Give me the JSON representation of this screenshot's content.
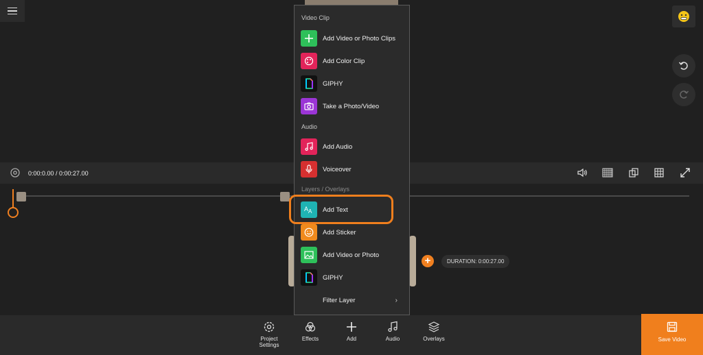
{
  "timeline": {
    "time": "0:00:0.00 / 0:00:27.00",
    "duration": "DURATION: 0:00:27.00"
  },
  "menu": {
    "sections": {
      "video_clip": "Video Clip",
      "audio": "Audio",
      "layers": "Layers / Overlays"
    },
    "items": [
      {
        "label": "Add Video or Photo Clips",
        "icon": "plus-icon",
        "color": "#2ec05a"
      },
      {
        "label": "Add Color Clip",
        "icon": "palette-icon",
        "color": "#e2245a"
      },
      {
        "label": "GIPHY",
        "icon": "giphy-icon",
        "color": "#111111"
      },
      {
        "label": "Take a Photo/Video",
        "icon": "camera-icon",
        "color": "#9b35d6"
      },
      {
        "label": "Add Audio",
        "icon": "music-note-icon",
        "color": "#e2245a"
      },
      {
        "label": "Voiceover",
        "icon": "microphone-icon",
        "color": "#d63030"
      },
      {
        "label": "Add Text",
        "icon": "text-icon",
        "color": "#1fb3b3"
      },
      {
        "label": "Add Sticker",
        "icon": "smiley-icon",
        "color": "#f08a1d"
      },
      {
        "label": "Add Video or Photo",
        "icon": "image-icon",
        "color": "#2ec05a"
      },
      {
        "label": "GIPHY",
        "icon": "giphy-icon",
        "color": "#111111"
      },
      {
        "label": "Filter Layer",
        "icon": "none",
        "color": "#2b2b2b"
      }
    ]
  },
  "toolbar": {
    "project_settings": "Project Settings",
    "effects": "Effects",
    "add": "Add",
    "audio": "Audio",
    "overlays": "Overlays",
    "save": "Save Video"
  },
  "colors": {
    "accent": "#f07f1d",
    "background": "#202020"
  }
}
